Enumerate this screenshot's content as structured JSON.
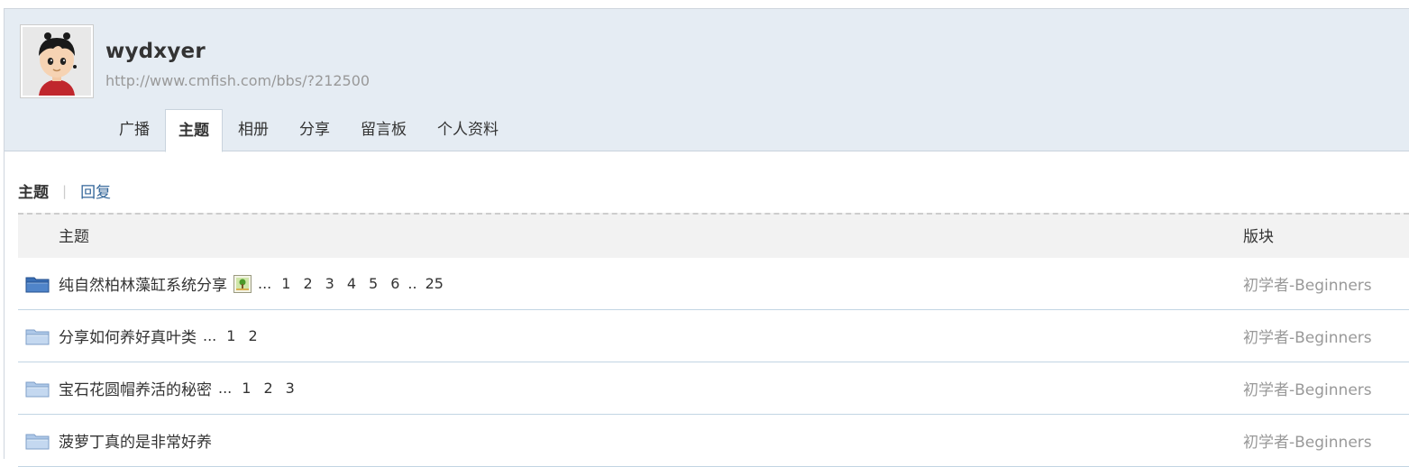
{
  "profile": {
    "username": "wydxyer",
    "url": "http://www.cmfish.com/bbs/?212500"
  },
  "tabs": [
    {
      "label": "广播",
      "active": false
    },
    {
      "label": "主题",
      "active": true
    },
    {
      "label": "相册",
      "active": false
    },
    {
      "label": "分享",
      "active": false
    },
    {
      "label": "留言板",
      "active": false
    },
    {
      "label": "个人资料",
      "active": false
    }
  ],
  "sub_tabs": {
    "active": "主题",
    "other": "回复"
  },
  "table": {
    "col_topic": "主题",
    "col_forum": "版块",
    "rows": [
      {
        "title": "纯自然柏林藻缸系统分享",
        "has_image": true,
        "ellipsis": "...",
        "pages": [
          "1",
          "2",
          "3",
          "4",
          "5",
          "6"
        ],
        "dots": "..",
        "last_page": "25",
        "forum": "初学者-Beginners",
        "folder": "new"
      },
      {
        "title": "分享如何养好真叶类",
        "has_image": false,
        "ellipsis": "...",
        "pages": [
          "1",
          "2"
        ],
        "forum": "初学者-Beginners",
        "folder": "normal"
      },
      {
        "title": "宝石花圆帽养活的秘密",
        "has_image": false,
        "ellipsis": "...",
        "pages": [
          "1",
          "2",
          "3"
        ],
        "forum": "初学者-Beginners",
        "folder": "normal"
      },
      {
        "title": "菠萝丁真的是非常好养",
        "has_image": false,
        "ellipsis": "",
        "pages": [],
        "forum": "初学者-Beginners",
        "folder": "normal"
      }
    ]
  },
  "colors": {
    "header_bg": "#e5ecf3",
    "link_blue": "#336699",
    "forum_gray": "#999999",
    "row_border": "#c2d5e3"
  }
}
